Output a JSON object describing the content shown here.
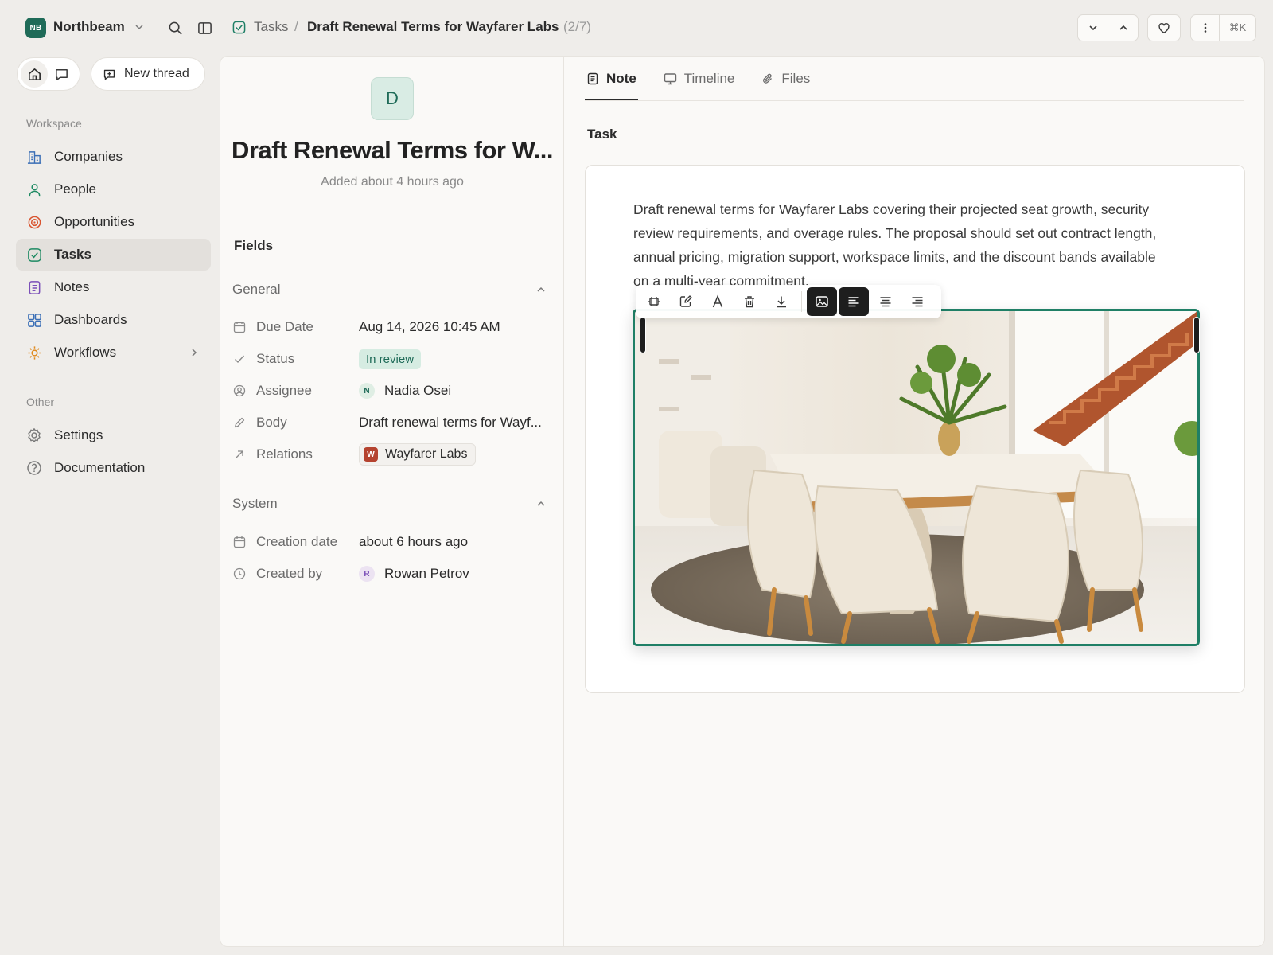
{
  "workspace": {
    "initials": "NB",
    "name": "Northbeam"
  },
  "breadcrumb": {
    "parent": "Tasks",
    "separator": "/",
    "title": "Draft Renewal Terms for Wayfarer Labs",
    "count": "(2/7)"
  },
  "topbar": {
    "shortcut": "⌘K"
  },
  "sidebar": {
    "new_thread": "New thread",
    "workspace_label": "Workspace",
    "other_label": "Other",
    "items": [
      {
        "label": "Companies",
        "icon": "building-icon"
      },
      {
        "label": "People",
        "icon": "person-icon"
      },
      {
        "label": "Opportunities",
        "icon": "target-icon"
      },
      {
        "label": "Tasks",
        "icon": "checkbox-icon",
        "active": true
      },
      {
        "label": "Notes",
        "icon": "note-icon"
      },
      {
        "label": "Dashboards",
        "icon": "grid-icon"
      },
      {
        "label": "Workflows",
        "icon": "sun-icon"
      }
    ],
    "other_items": [
      {
        "label": "Settings",
        "icon": "gear-icon"
      },
      {
        "label": "Documentation",
        "icon": "help-icon"
      }
    ]
  },
  "record": {
    "avatar_letter": "D",
    "title": "Draft Renewal Terms for W...",
    "added": "Added about 4 hours ago",
    "fields_heading": "Fields",
    "general_heading": "General",
    "system_heading": "System",
    "general": {
      "due_date_label": "Due Date",
      "due_date": "Aug 14, 2026 10:45 AM",
      "status_label": "Status",
      "status": "In review",
      "assignee_label": "Assignee",
      "assignee_initial": "N",
      "assignee": "Nadia Osei",
      "body_label": "Body",
      "body": "Draft renewal terms for Wayf...",
      "relations_label": "Relations",
      "relation_initial": "W",
      "relation": "Wayfarer Labs"
    },
    "system": {
      "creation_label": "Creation date",
      "creation": "about 6 hours ago",
      "created_by_label": "Created by",
      "created_by_initial": "R",
      "created_by": "Rowan Petrov"
    }
  },
  "tabs": [
    {
      "label": "Note",
      "icon": "note-icon",
      "active": true
    },
    {
      "label": "Timeline",
      "icon": "monitor-icon"
    },
    {
      "label": "Files",
      "icon": "paperclip-icon"
    }
  ],
  "note": {
    "heading": "Task",
    "body": "Draft renewal terms for Wayfarer Labs covering their projected seat growth, security review requirements, and overage rules. The proposal should set out contract length, annual pricing, migration support, workspace limits, and the discount bands available on a multi-year commitment."
  },
  "colors": {
    "accent": "#1f6b58",
    "status_bg": "#d6ece2",
    "frame": "#1f7f66"
  }
}
